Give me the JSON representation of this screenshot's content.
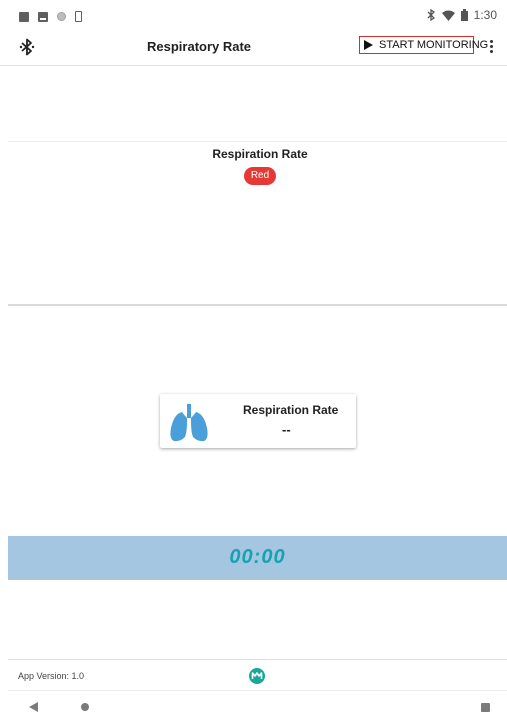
{
  "status_bar": {
    "time": "1:30",
    "icons": [
      "square-notification-icon",
      "image-notification-icon",
      "circle-notification-icon",
      "phone-notification-icon",
      "bluetooth-icon",
      "wifi-icon",
      "battery-icon"
    ]
  },
  "app_bar": {
    "title": "Respiratory Rate",
    "start_label": "START MONITORING",
    "icons": [
      "bluetooth-icon",
      "play-icon",
      "overflow-menu-icon"
    ]
  },
  "respiration": {
    "title": "Respiration Rate",
    "status_label": "Red",
    "status_color": "#e53935"
  },
  "card": {
    "label": "Respiration Rate",
    "value": "--",
    "icon": "lungs-icon",
    "icon_color": "#4a9fdb"
  },
  "timer": {
    "value": "00:00",
    "band_color": "#a4c6e0",
    "text_color": "#15a3b4"
  },
  "footer": {
    "app_version": "App Version: 1.0",
    "logo": "maxim-logo-icon",
    "logo_color": "#18a79a"
  },
  "nav_bar": {
    "icons": [
      "back-icon",
      "home-icon",
      "recents-icon"
    ]
  }
}
